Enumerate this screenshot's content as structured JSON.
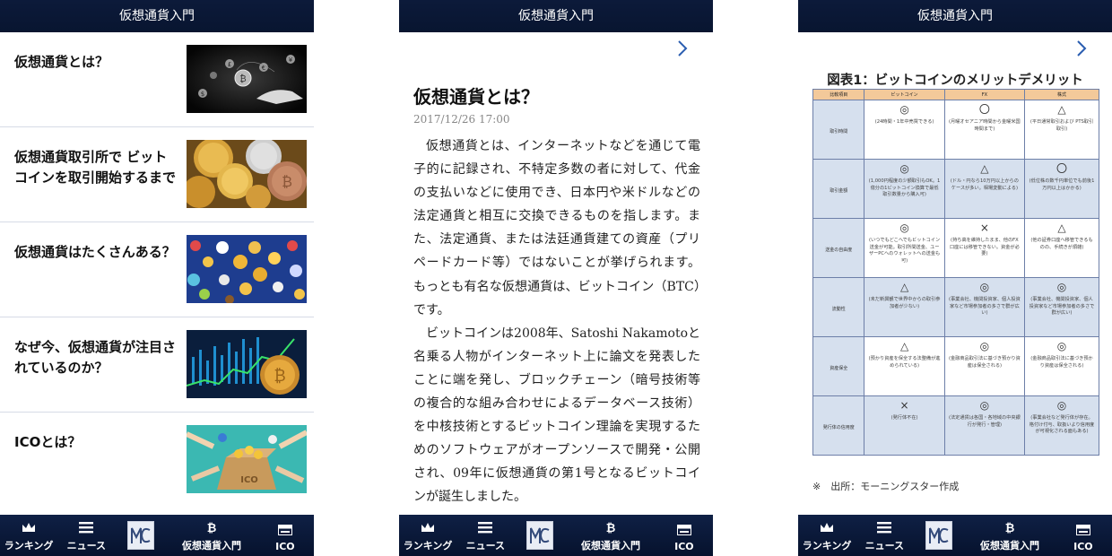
{
  "header_title": "仮想通貨入門",
  "tabs": [
    {
      "label": "ランキング",
      "icon": "crown-icon"
    },
    {
      "label": "ニュース",
      "icon": "news-list-icon"
    },
    {
      "label": "",
      "icon": "mc-logo-icon"
    },
    {
      "label": "仮想通貨入門",
      "icon": "bitcoin-icon"
    },
    {
      "label": "ICO",
      "icon": "ico-icon"
    }
  ],
  "list": {
    "items": [
      {
        "title": "仮想通貨とは？",
        "thumb": "coins-hand-image"
      },
      {
        "title": "仮想通貨取引所で ビットコインを取引開始するまで",
        "thumb": "gold-coins-image"
      },
      {
        "title": "仮想通貨はたくさんある？",
        "thumb": "many-coins-image"
      },
      {
        "title": "なぜ今、仮想通貨が注目されているのか？",
        "thumb": "chart-coin-image"
      },
      {
        "title": "ICOとは？",
        "thumb": "ico-box-image"
      }
    ]
  },
  "article": {
    "title": "仮想通貨とは？",
    "date": "2017/12/26 17:00",
    "paragraphs": [
      "仮想通貨とは、インターネットなどを通じて電子的に記録され、不特定多数の者に対して、代金の支払いなどに使用でき、日本円や米ドルなどの法定通貨と相互に交換できるものを指します。また、法定通貨、または法廷通貨建ての資産（プリペードカード等）ではないことが挙げられます。もっとも有名な仮想通貨は、ビットコイン（BTC）です。",
      "ビットコインは2008年、Satoshi Nakamotoと名乗る人物がインターネット上に論文を発表したことに端を発し、ブロックチェーン（暗号技術等の複合的な組み合わせによるデータベース技術）を中核技術とするビットコイン理論を実現するためのソフトウェアがオープンソースで開発・公開され、09年に仮想通貨の第1号となるビットコインが誕生しました。"
    ]
  },
  "figure": {
    "title": "図表1：ビットコインのメリットデメリット",
    "headers": [
      "比較項目",
      "ビットコイン",
      "FX",
      "株式"
    ],
    "rows": [
      {
        "label": "取引時間",
        "cells": [
          {
            "mark": "◎",
            "note": "(24時間・1年中売買できる)"
          },
          {
            "mark": "〇",
            "note": "(月曜オセアニア時間から金曜米国時間まで)"
          },
          {
            "mark": "△",
            "note": "(平日通常取引および PTS取引取引)"
          }
        ]
      },
      {
        "label": "取引金額",
        "cells": [
          {
            "mark": "◎",
            "note": "(1,000円程度の少額取引もOK。1億分の1ビットコイン換算で最低取引数量から購入可)"
          },
          {
            "mark": "△",
            "note": "(ドル・円なら10万円以上からのケースが多い。相場変動による)"
          },
          {
            "mark": "〇",
            "note": "(低位株の数千円単位でも前後1万円以上はかかる)"
          }
        ]
      },
      {
        "label": "送金の自由度",
        "cells": [
          {
            "mark": "◎",
            "note": "(いつでもどこへでもビットコイン送金が可能。取引所間送金、ユーザーPCへのウォレットへの送金も可)"
          },
          {
            "mark": "×",
            "note": "(持ち高を維持したまま、他のFX口座には移管できない。資金が必要)"
          },
          {
            "mark": "△",
            "note": "(他の証券口座へ移管できるものの、手続きが煩雑)"
          }
        ]
      },
      {
        "label": "流動性",
        "cells": [
          {
            "mark": "△",
            "note": "(未だ新興観で世界中からの取引参加者が少ない)"
          },
          {
            "mark": "◎",
            "note": "(事業会社、機関投資家、個人投資家など市場参加者の多さで群が広い)"
          },
          {
            "mark": "◎",
            "note": "(事業会社、機関投資家、個人投資家など市場参加者の多さで群が広い)"
          }
        ]
      },
      {
        "label": "資産保全",
        "cells": [
          {
            "mark": "△",
            "note": "(預かり資産を保全する法整備が進められている)"
          },
          {
            "mark": "◎",
            "note": "(金融商品取引法に基づき預かり資産は保全される)"
          },
          {
            "mark": "◎",
            "note": "(金融商品取引法に基づき預かり資産は保全される)"
          }
        ]
      },
      {
        "label": "発行体の信用度",
        "cells": [
          {
            "mark": "×",
            "note": "(発行体不在)"
          },
          {
            "mark": "◎",
            "note": "(法定通貨は各国・各地域の中央銀行が発行・管理)"
          },
          {
            "mark": "◎",
            "note": "(事業会社など発行体が存在。格付け付与、取扱いより信用度が可視化される面もある)"
          }
        ]
      }
    ],
    "source": "※　出所：モーニングスター作成"
  }
}
